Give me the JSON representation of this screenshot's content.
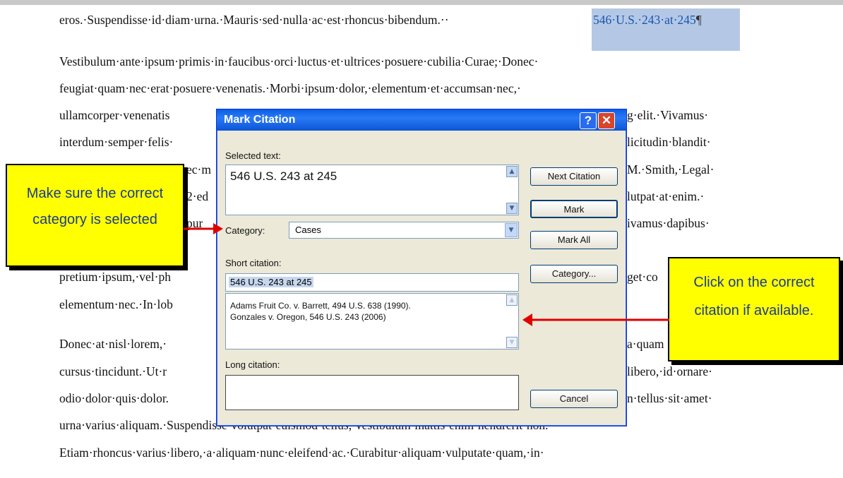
{
  "document": {
    "line1": "eros.·Suspendisse·id·diam·urna.·Mauris·sed·nulla·ac·est·rhoncus·bibendum.··",
    "line1_selected": "546·U.S.·243·at·245",
    "pilcrow": "¶",
    "line2": "Vestibulum·ante·ipsum·primis·in·faucibus·orci·luctus·et·ultrices·posuere·cubilia·Curae;·Donec·",
    "line3": "feugiat·quam·nec·erat·posuere·venenatis.·Morbi·ipsum·dolor,·elementum·et·accumsan·nec,·",
    "line4_left": "ullamcorper·venenatis",
    "line4_right": "g·elit.·Vivamus·",
    "line5_left": "interdum·semper·felis·",
    "line5_right": "licitudin·blandit·",
    "line6_left": "ec·m",
    "line6_right": "M.·Smith,·Legal·",
    "line7_left": "2·ed",
    "line7_right": "lutpat·at·enim.·",
    "line8_left": "pur",
    "line8_right": "ivamus·dapibus·",
    "line9_left": "pretium·ipsum,·vel·ph",
    "line9_right": "get·co",
    "line10_left": "elementum·nec.·In·lob",
    "line11_left": "Donec·at·nisl·lorem,·",
    "line11_right": "a·quam",
    "line12_left": "cursus·tincidunt.·Ut·r",
    "line12_right": "libero,·id·ornare·",
    "line13_left": "odio·dolor·quis·dolor.",
    "line13_right": "n·tellus·sit·amet·",
    "line14": "urna·varius·aliquam.·Suspendisse·volutpat·euismod·tellus,·vestibulum·mattis·enim·hendrerit·non.·",
    "line15": "Etiam·rhoncus·varius·libero,·a·aliquam·nunc·eleifend·ac.·Curabitur·aliquam·vulputate·quam,·in·"
  },
  "dialog": {
    "title": "Mark Citation",
    "help_label": "?",
    "close_label": "✕",
    "selected_text_label": "Selected text:",
    "selected_text_value": "546 U.S. 243 at 245",
    "category_label": "Category:",
    "category_value": "Cases",
    "short_citation_label": "Short citation:",
    "short_citation_value": "546 U.S. 243 at 245",
    "citation_list": [
      "Adams Fruit Co. v. Barrett, 494 U.S. 638 (1990).",
      "Gonzales v. Oregon, 546 U.S. 243 (2006)"
    ],
    "long_citation_label": "Long citation:",
    "buttons": {
      "next_citation": "Next Citation",
      "mark": "Mark",
      "mark_all": "Mark All",
      "category": "Category...",
      "cancel": "Cancel"
    }
  },
  "callouts": {
    "left_text": "Make sure the correct category is selected",
    "right_text": "Click on the correct citation if available."
  },
  "colors": {
    "callout_bg": "#ffff00",
    "callout_text": "#1a3c8a",
    "arrow": "#e00000",
    "title_bar": "#0a5fe6",
    "selection": "#b4c8e6"
  }
}
